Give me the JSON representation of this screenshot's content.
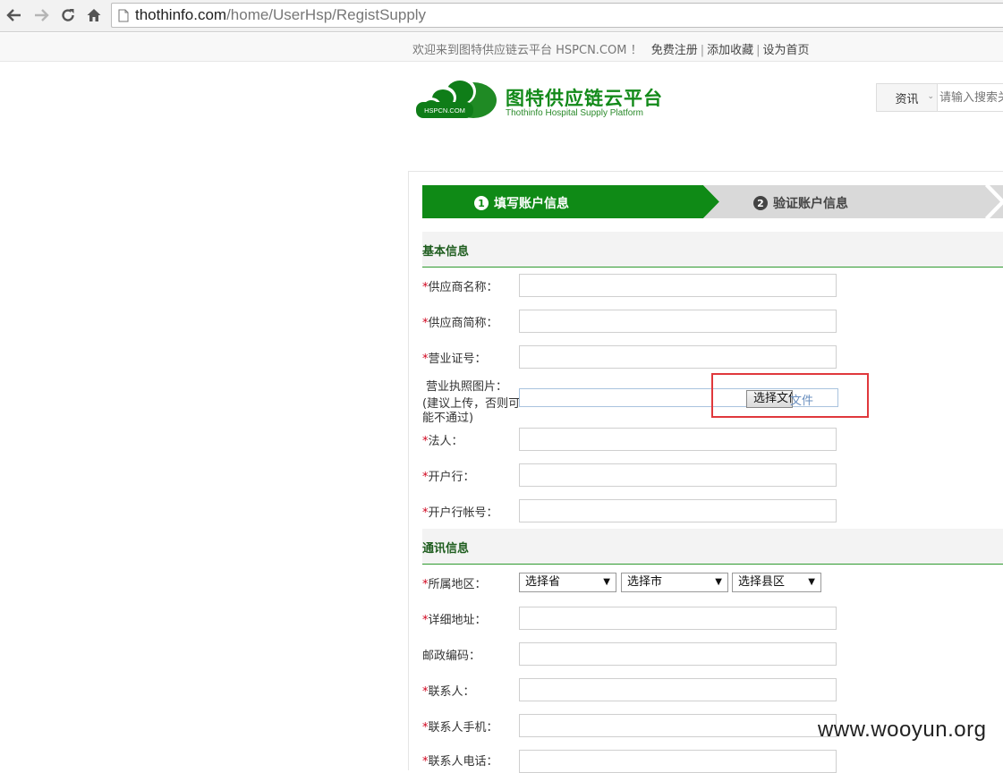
{
  "browser": {
    "url_host": "thothinfo.com",
    "url_path": "/home/UserHsp/RegistSupply"
  },
  "topbar": {
    "welcome": "欢迎来到图特供应链云平台 HSPCN.COM ！",
    "links": [
      "免费注册",
      "添加收藏",
      "设为首页"
    ]
  },
  "logo": {
    "cn": "图特供应链云平台",
    "en": "Thothinfo Hospital Supply Platform",
    "badge": "HSPCN.COM"
  },
  "search": {
    "category": "资讯",
    "placeholder": "请输入搜索关"
  },
  "steps": [
    {
      "num": "1",
      "label": "填写账户信息"
    },
    {
      "num": "2",
      "label": "验证账户信息"
    }
  ],
  "sections": {
    "basic": "基本信息",
    "contact": "通讯信息"
  },
  "fields": {
    "supplier_name": "供应商名称：",
    "supplier_short": "供应商简称：",
    "license_no": "营业证号：",
    "license_img": "营业执照图片：",
    "license_hint_1": "(建议上传，否则可",
    "license_hint_2": "能不通过)",
    "legal_person": "法人：",
    "bank": "开户行：",
    "bank_account": "开户行帐号：",
    "region": "所属地区：",
    "address": "详细地址：",
    "postcode": "邮政编码：",
    "contact_person": "联系人：",
    "contact_mobile": "联系人手机：",
    "contact_phone": "联系人电话："
  },
  "file": {
    "button": "选择文件",
    "tail": "文件"
  },
  "selects": {
    "province": "选择省",
    "city": "选择市",
    "county": "选择县区"
  },
  "watermark": "www.wooyun.org",
  "colors": {
    "brand_green": "#0f8a16",
    "step_inactive": "#d9d9d9",
    "required": "#d0021b",
    "highlight": "#e0383c"
  }
}
